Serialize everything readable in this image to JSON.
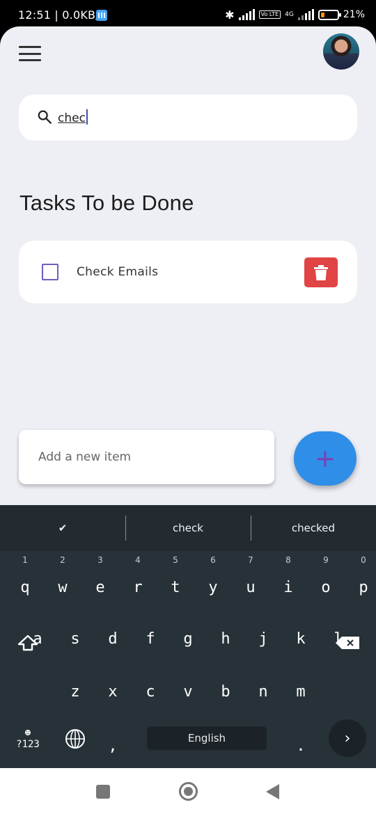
{
  "status_bar": {
    "time": "12:51",
    "speed": "0.0KB/s",
    "network": "4G",
    "volte": "Vo LTE",
    "battery_text": "21%",
    "battery_level": 0.21
  },
  "header": {
    "menu_icon": "hamburger-menu-icon",
    "avatar": "user-avatar"
  },
  "search": {
    "icon": "search-icon",
    "value": "chec"
  },
  "section": {
    "title": "Tasks To be Done"
  },
  "tasks": [
    {
      "label": "Check Emails",
      "checked": false
    }
  ],
  "add_item": {
    "placeholder": "Add a new item",
    "fab_label": "+"
  },
  "keyboard": {
    "suggestions": [
      "✔",
      "check",
      "checked"
    ],
    "row1": [
      "q",
      "w",
      "e",
      "r",
      "t",
      "y",
      "u",
      "i",
      "o",
      "p"
    ],
    "row1_hints": [
      "1",
      "2",
      "3",
      "4",
      "5",
      "6",
      "7",
      "8",
      "9",
      "0"
    ],
    "row2": [
      "a",
      "s",
      "d",
      "f",
      "g",
      "h",
      "j",
      "k",
      "l"
    ],
    "row3": [
      "z",
      "x",
      "c",
      "v",
      "b",
      "n",
      "m"
    ],
    "symbols_key": "?123",
    "comma": ",",
    "space_label": "English",
    "period": ".",
    "enter": "›"
  },
  "colors": {
    "accent": "#2f8ee8",
    "delete": "#e04444",
    "checkbox": "#6a5fc1",
    "background": "#eeeff5",
    "keyboard": "#263238"
  }
}
